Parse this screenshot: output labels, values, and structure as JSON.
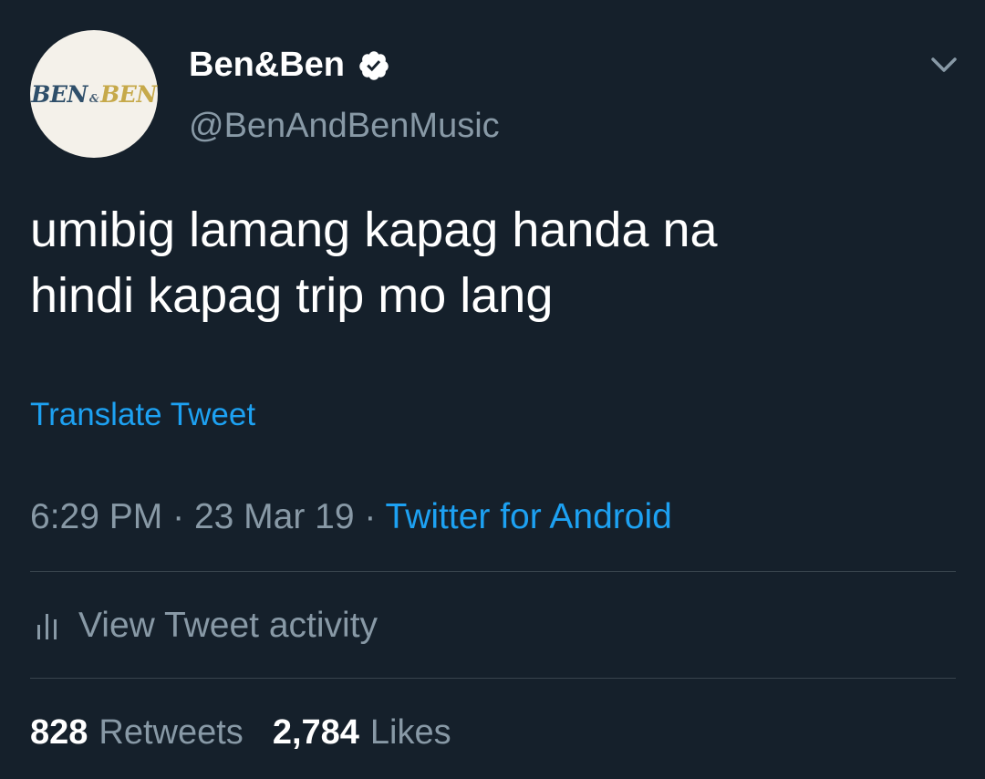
{
  "author": {
    "avatar_logo": {
      "word_a": "BEN",
      "amp": "&",
      "word_b": "BEN"
    },
    "name": "Ben&Ben",
    "handle": "@BenAndBenMusic",
    "verified": true
  },
  "icons": {
    "verified": "verified-badge-icon",
    "menu": "chevron-down-icon",
    "activity": "bar-chart-icon"
  },
  "tweet": {
    "lines": [
      "umibig lamang kapag handa na",
      "hindi kapag trip mo lang"
    ],
    "translate_label": "Translate Tweet"
  },
  "meta": {
    "time": "6:29 PM",
    "separator": "·",
    "date": "23 Mar 19",
    "source": "Twitter for Android"
  },
  "activity": {
    "label": "View Tweet activity"
  },
  "stats": {
    "retweets_count": "828",
    "retweets_label": "Retweets",
    "likes_count": "2,784",
    "likes_label": "Likes"
  },
  "colors": {
    "background": "#15202b",
    "text_primary": "#ffffff",
    "text_secondary": "#8899a6",
    "accent": "#1da1f2",
    "divider": "#38444d"
  }
}
